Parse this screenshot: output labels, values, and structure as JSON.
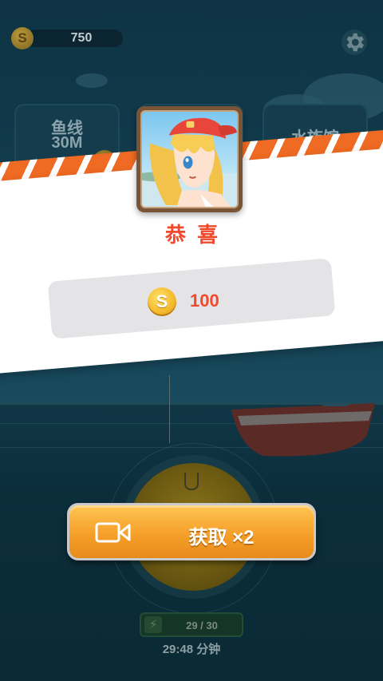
{
  "hud": {
    "coins": "750",
    "coin_icon": "coin-icon",
    "settings_icon": "gear-icon"
  },
  "upgrade_cards": [
    {
      "label_line1": "鱼线",
      "label_line2": "30M"
    },
    {
      "label_line1": "",
      "label_line2": ""
    },
    {
      "label_line1": "水族馆",
      "label_line2": ""
    }
  ],
  "energy": {
    "value": "29 / 30",
    "icon": "lightning-icon",
    "timer": "29:48 分钟"
  },
  "reward_dialog": {
    "title": "恭喜",
    "reward_amount": "100",
    "reward_icon": "coin-icon",
    "action_label": "获取 ×2",
    "action_icon": "video-camera-icon"
  },
  "colors": {
    "accent_orange": "#ef6a22",
    "title_red": "#f04a2c",
    "button_gold": "#f5a02a",
    "coin_gold": "#f4b92a"
  }
}
